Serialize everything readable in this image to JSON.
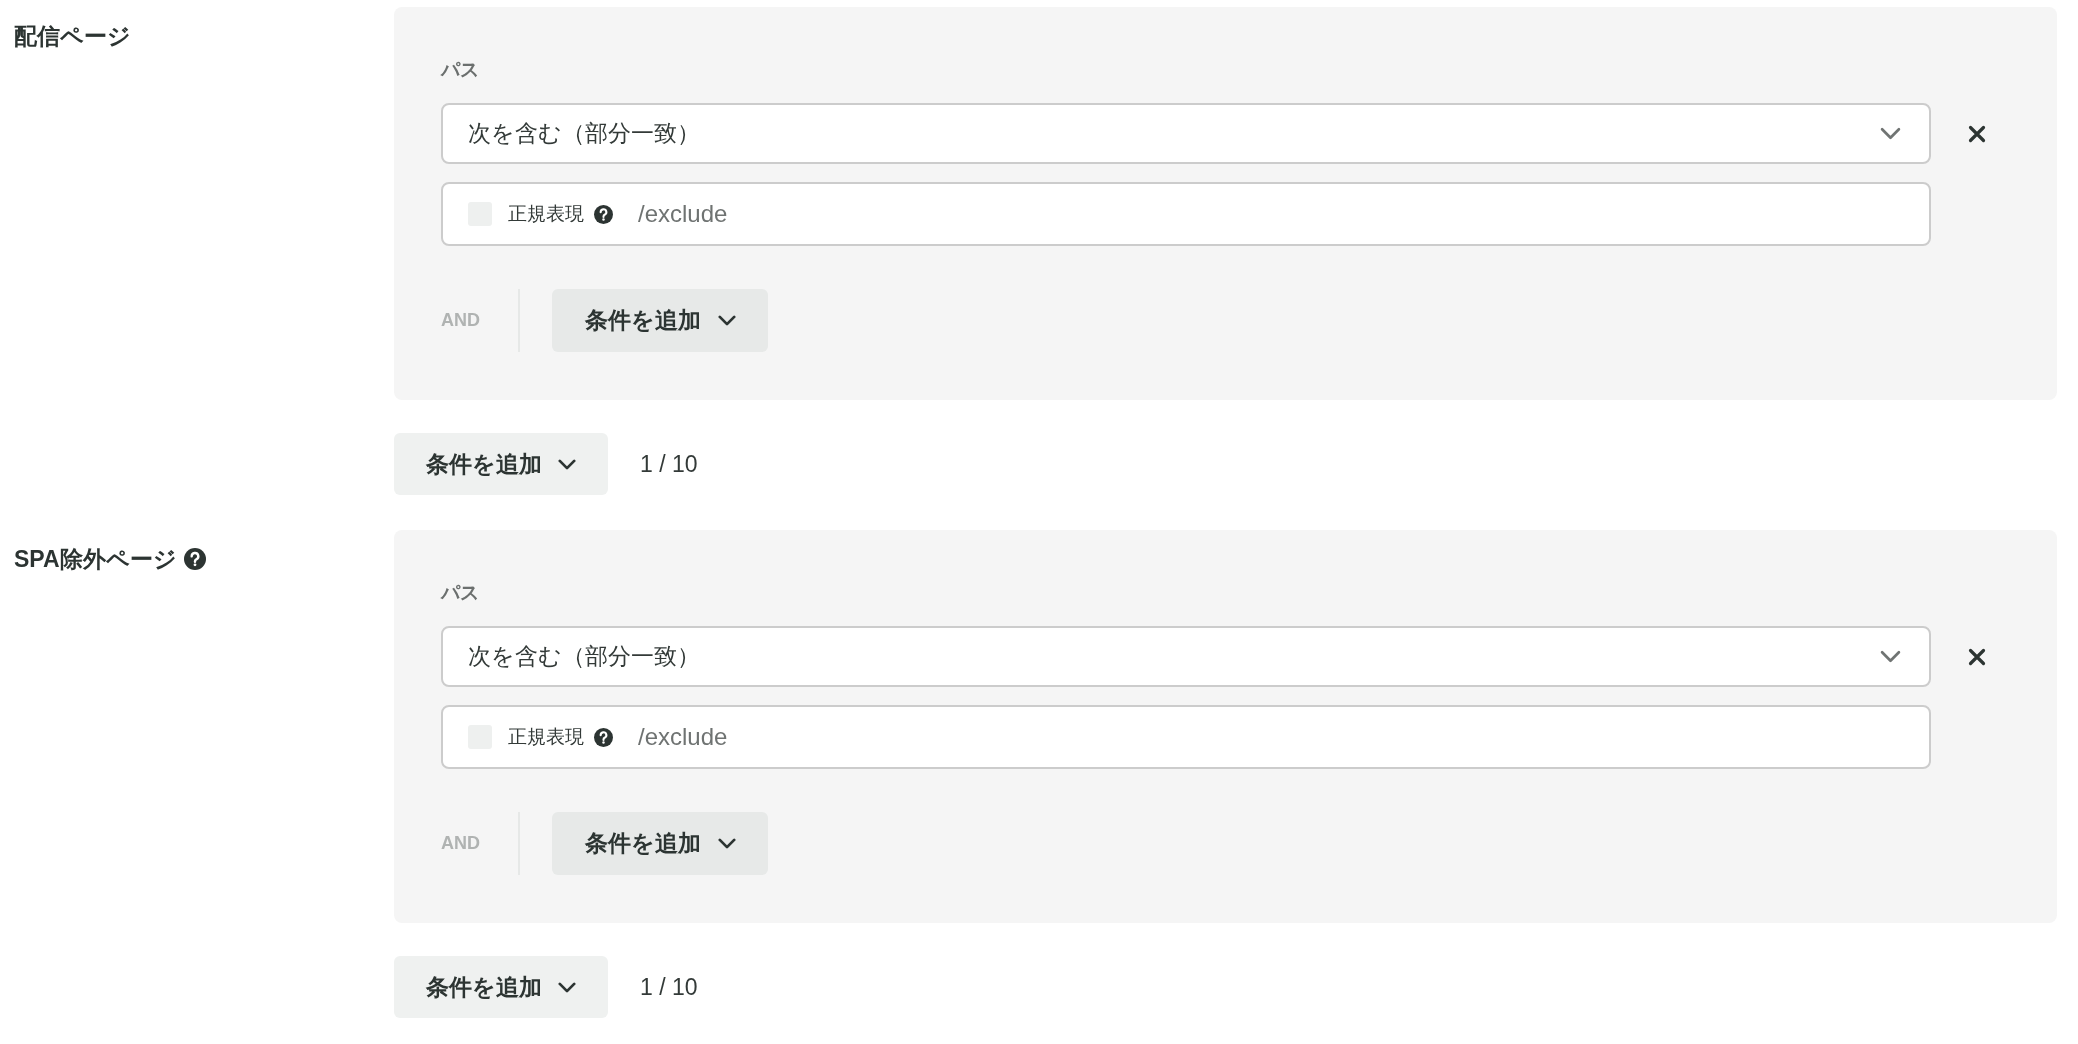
{
  "sections": [
    {
      "label": "配信ページ",
      "help": false,
      "conditions": [
        {
          "field_label": "パス",
          "match": "次を含む（部分一致）",
          "regex": {
            "label": "正規表現",
            "checked": false
          },
          "path": {
            "placeholder": "/exclude"
          },
          "and_label": "AND",
          "add_button": "条件を追加"
        }
      ],
      "add_button": "条件を追加",
      "count": "1 / 10"
    },
    {
      "label": "SPA除外ページ",
      "help": true,
      "conditions": [
        {
          "field_label": "パス",
          "match": "次を含む（部分一致）",
          "regex": {
            "label": "正規表現",
            "checked": false
          },
          "path": {
            "placeholder": "/exclude"
          },
          "and_label": "AND",
          "add_button": "条件を追加"
        }
      ],
      "add_button": "条件を追加",
      "count": "1 / 10"
    }
  ]
}
